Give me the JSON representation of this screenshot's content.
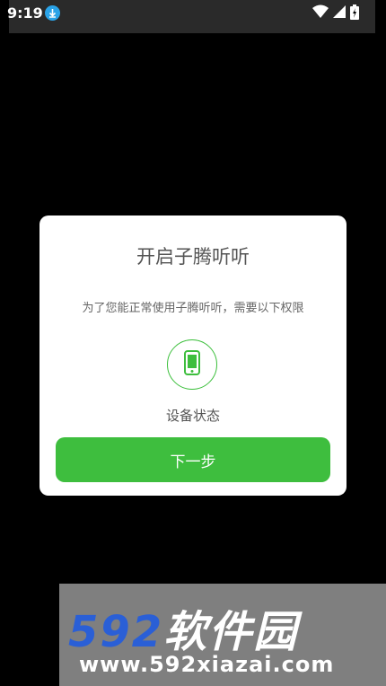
{
  "status_bar": {
    "time": "9:19"
  },
  "dialog": {
    "title": "开启子腾听听",
    "subtitle": "为了您能正常使用子腾听听，需要以下权限",
    "permission_label": "设备状态",
    "next_button": "下一步"
  },
  "watermark": {
    "brand_num": "592",
    "brand_cn": "软件园",
    "url": "www.592xiazai.com"
  },
  "colors": {
    "accent_green": "#3ebe3e",
    "download_blue": "#2aa3e8",
    "watermark_blue": "#2a5fd6"
  }
}
